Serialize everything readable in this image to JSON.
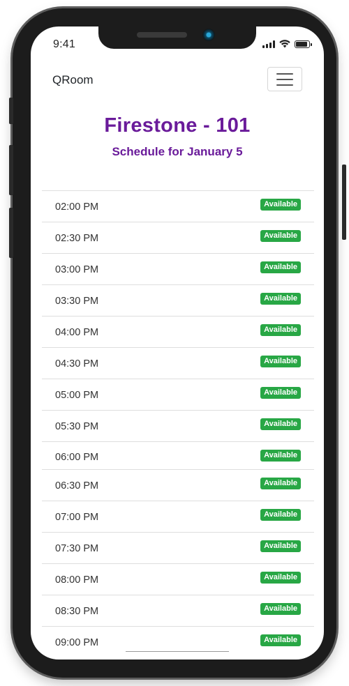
{
  "status_bar": {
    "time": "9:41",
    "icons": [
      "signal-icon",
      "wifi-icon",
      "battery-icon"
    ]
  },
  "navbar": {
    "brand": "QRoom",
    "toggler_icon": "hamburger-icon"
  },
  "header": {
    "title": "Firestone - 101",
    "subtitle": "Schedule for January 5"
  },
  "schedule": {
    "badge_color": "#28a745",
    "title_color": "#6a1b9a",
    "slots": [
      {
        "time": "02:00 PM",
        "status": "Available"
      },
      {
        "time": "02:30 PM",
        "status": "Available"
      },
      {
        "time": "03:00 PM",
        "status": "Available"
      },
      {
        "time": "03:30 PM",
        "status": "Available"
      },
      {
        "time": "04:00 PM",
        "status": "Available"
      },
      {
        "time": "04:30 PM",
        "status": "Available"
      },
      {
        "time": "05:00 PM",
        "status": "Available"
      },
      {
        "time": "05:30 PM",
        "status": "Available"
      },
      {
        "time": "06:00 PM",
        "status": "Available"
      },
      {
        "time": "06:30 PM",
        "status": "Available"
      },
      {
        "time": "07:00 PM",
        "status": "Available"
      },
      {
        "time": "07:30 PM",
        "status": "Available"
      },
      {
        "time": "08:00 PM",
        "status": "Available"
      },
      {
        "time": "08:30 PM",
        "status": "Available"
      },
      {
        "time": "09:00 PM",
        "status": "Available"
      }
    ]
  }
}
